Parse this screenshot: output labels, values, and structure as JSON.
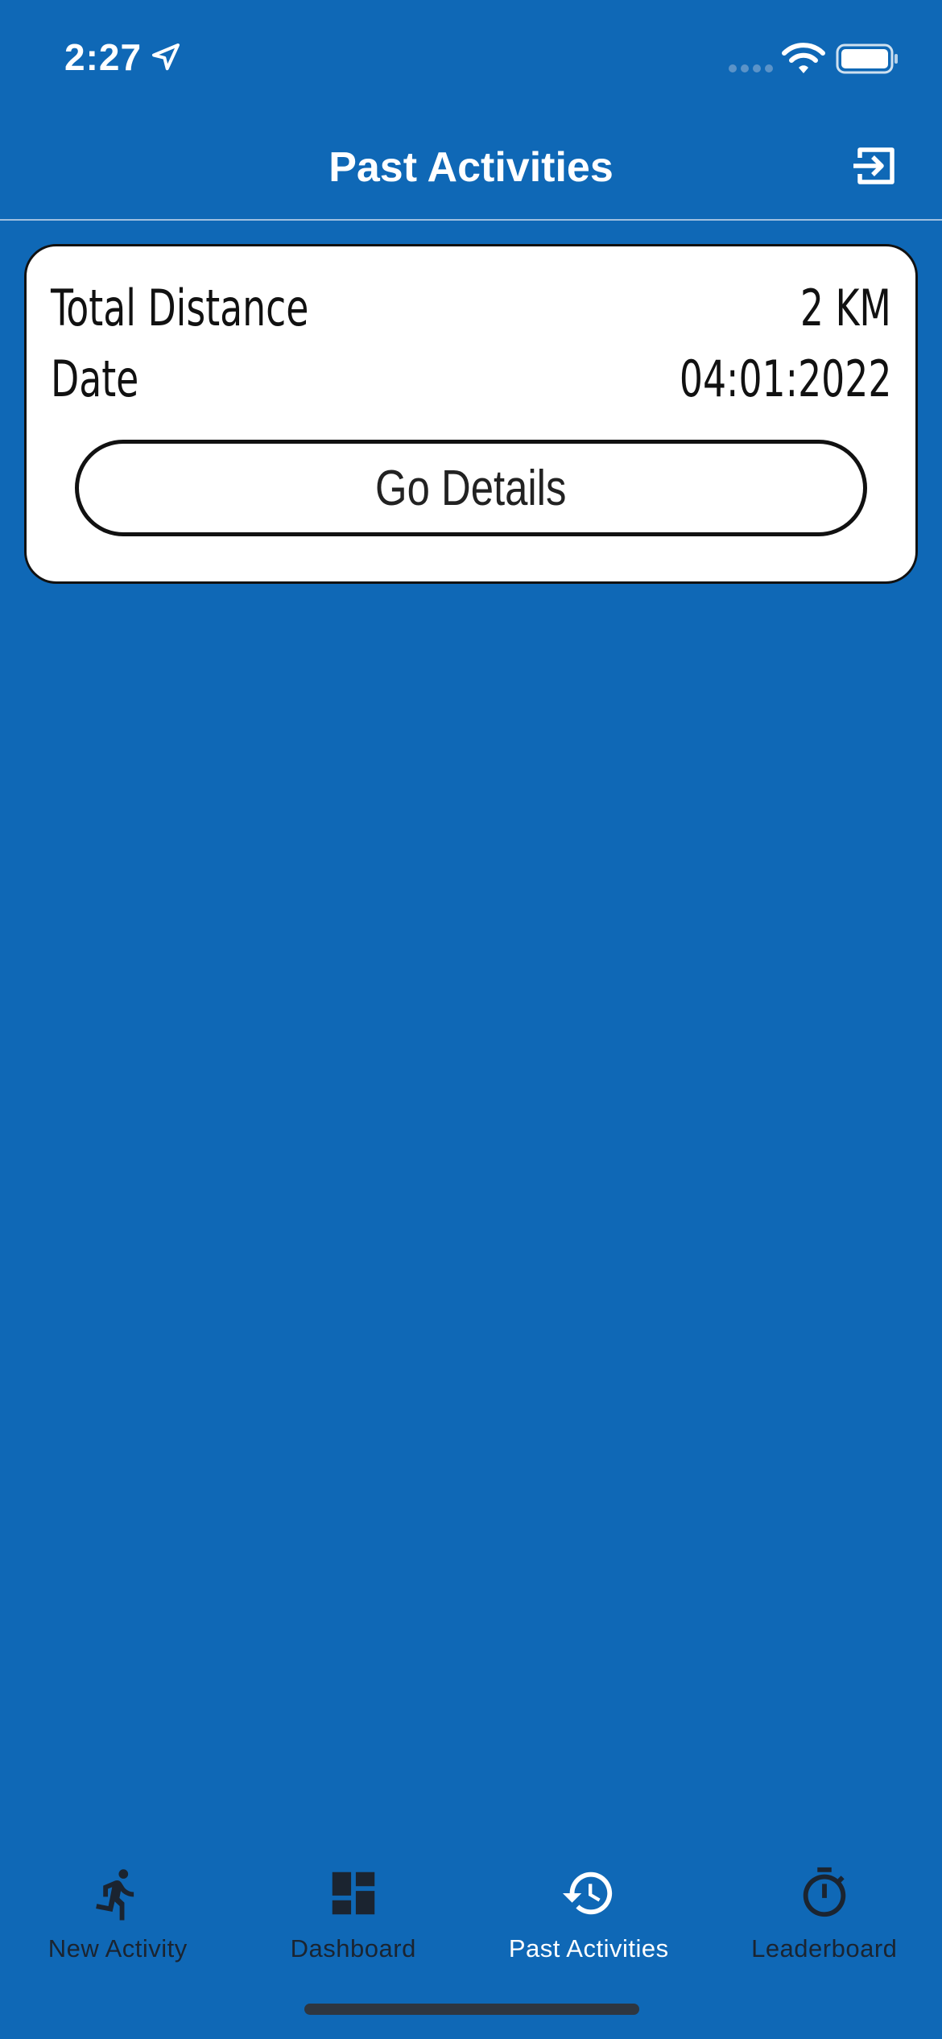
{
  "status_bar": {
    "time": "2:27",
    "icons": [
      "location-arrow-icon",
      "signal-dots-icon",
      "wifi-icon",
      "battery-icon"
    ]
  },
  "nav": {
    "title": "Past Activities",
    "right_icon": "logout-icon"
  },
  "activities": [
    {
      "distance_label": "Total Distance",
      "distance_value": "2 KM",
      "date_label": "Date",
      "date_value": "04:01:2022",
      "button_label": "Go Details"
    }
  ],
  "tabs": [
    {
      "label": "New Activity",
      "icon": "running-person-icon",
      "active": false
    },
    {
      "label": "Dashboard",
      "icon": "dashboard-icon",
      "active": false
    },
    {
      "label": "Past Activities",
      "icon": "history-icon",
      "active": true
    },
    {
      "label": "Leaderboard",
      "icon": "stopwatch-icon",
      "active": false
    }
  ],
  "colors": {
    "background": "#0f68b6",
    "card": "#ffffff",
    "tab_inactive": "#1b2430",
    "tab_active": "#ffffff"
  }
}
